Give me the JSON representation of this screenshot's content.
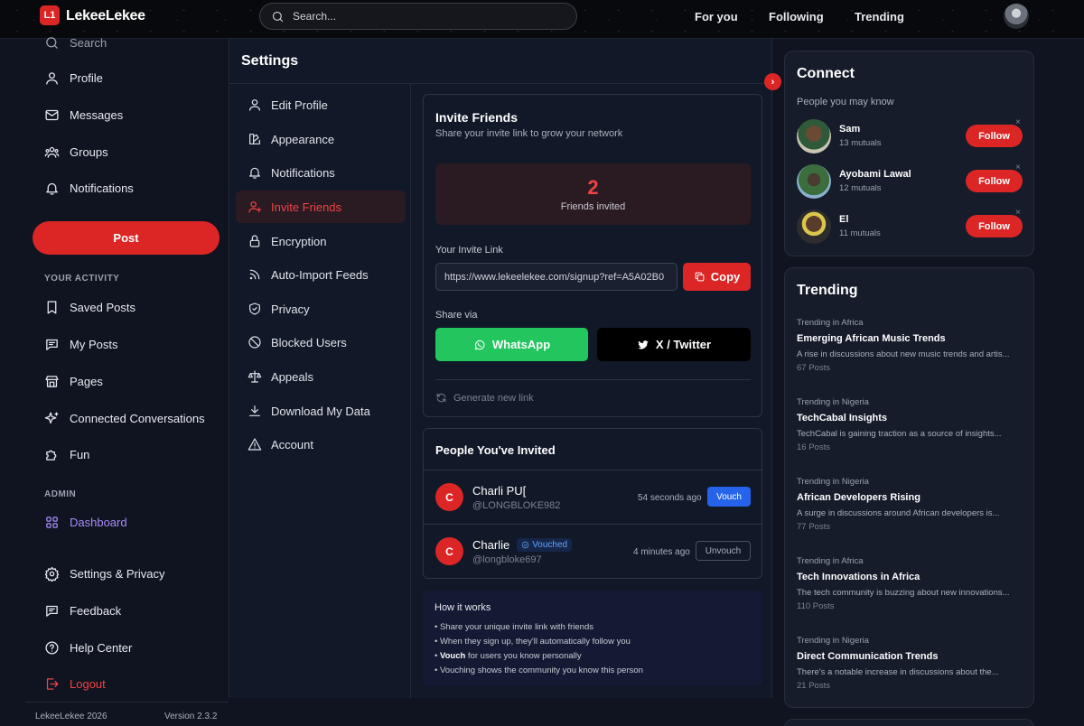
{
  "app": {
    "logo_text": "L1",
    "brand": "LekeeLekee"
  },
  "search": {
    "placeholder": "Search..."
  },
  "topnav": [
    "For you",
    "Following",
    "Trending"
  ],
  "sidebar": {
    "partial_item": "Search",
    "items": [
      "Profile",
      "Messages",
      "Groups",
      "Notifications"
    ],
    "post_label": "Post",
    "activity_heading": "YOUR ACTIVITY",
    "activity_items": [
      "Saved Posts",
      "My Posts",
      "Pages",
      "Connected Conversations",
      "Fun"
    ],
    "admin_heading": "ADMIN",
    "admin_item": "Dashboard",
    "bottom_items": [
      "Settings & Privacy",
      "Feedback",
      "Help Center"
    ],
    "logout": "Logout",
    "footer_left": "LekeeLekee 2026",
    "footer_right": "Version 2.3.2"
  },
  "settings": {
    "title": "Settings",
    "menu": [
      "Edit Profile",
      "Appearance",
      "Notifications",
      "Invite Friends",
      "Encryption",
      "Auto-Import Feeds",
      "Privacy",
      "Blocked Users",
      "Appeals",
      "Download My Data",
      "Account"
    ],
    "active_item": "Invite Friends"
  },
  "invite": {
    "title": "Invite Friends",
    "subtitle": "Share your invite link to grow your network",
    "count": "2",
    "count_label": "Friends invited",
    "link_label": "Your Invite Link",
    "link_value": "https://www.lekeelekee.com/signup?ref=A5A02B0",
    "copy_label": "Copy",
    "share_label": "Share via",
    "whatsapp_label": "WhatsApp",
    "twitter_label": "X / Twitter",
    "generate_label": "Generate new link"
  },
  "invited": {
    "title": "People You've Invited",
    "people": [
      {
        "initial": "C",
        "name": "Charli PU[",
        "handle": "@LONGBLOKE982",
        "time": "54 seconds ago",
        "action": "Vouch",
        "badge": ""
      },
      {
        "initial": "C",
        "name": "Charlie",
        "handle": "@longbloke697",
        "time": "4 minutes ago",
        "action": "Unvouch",
        "badge": "Vouched"
      }
    ]
  },
  "how": {
    "title": "How it works",
    "items": [
      {
        "bold": "",
        "text": "Share your unique invite link with friends"
      },
      {
        "bold": "",
        "text": "When they sign up, they'll automatically follow you"
      },
      {
        "bold": "Vouch",
        "text": " for users you know personally"
      },
      {
        "bold": "",
        "text": "Vouching shows the community you know this person"
      }
    ]
  },
  "connect": {
    "title": "Connect",
    "subtitle": "People you may know",
    "follow_label": "Follow",
    "close_glyph": "×",
    "people": [
      {
        "name": "Sam",
        "mutuals": "13 mutuals"
      },
      {
        "name": "Ayobami Lawal",
        "mutuals": "12 mutuals"
      },
      {
        "name": "El",
        "mutuals": "11 mutuals"
      }
    ]
  },
  "trending": {
    "title": "Trending",
    "items": [
      {
        "category": "Trending in Africa",
        "title": "Emerging African Music Trends",
        "desc": "A rise in discussions about new music trends and artis...",
        "posts": "67 Posts"
      },
      {
        "category": "Trending in Nigeria",
        "title": "TechCabal Insights",
        "desc": "TechCabal is gaining traction as a source of insights...",
        "posts": "16 Posts"
      },
      {
        "category": "Trending in Nigeria",
        "title": "African Developers Rising",
        "desc": "A surge in discussions around African developers is...",
        "posts": "77 Posts"
      },
      {
        "category": "Trending in Africa",
        "title": "Tech Innovations in Africa",
        "desc": "The tech community is buzzing about new innovations...",
        "posts": "110 Posts"
      },
      {
        "category": "Trending in Nigeria",
        "title": "Direct Communication Trends",
        "desc": "There's a notable increase in discussions about the...",
        "posts": "21 Posts"
      }
    ]
  },
  "colors": {
    "accent": "#dc2626",
    "active_bg": "#2a1a22",
    "whatsapp": "#22c55e",
    "vouch": "#2563eb",
    "admin": "#a78bfa"
  }
}
